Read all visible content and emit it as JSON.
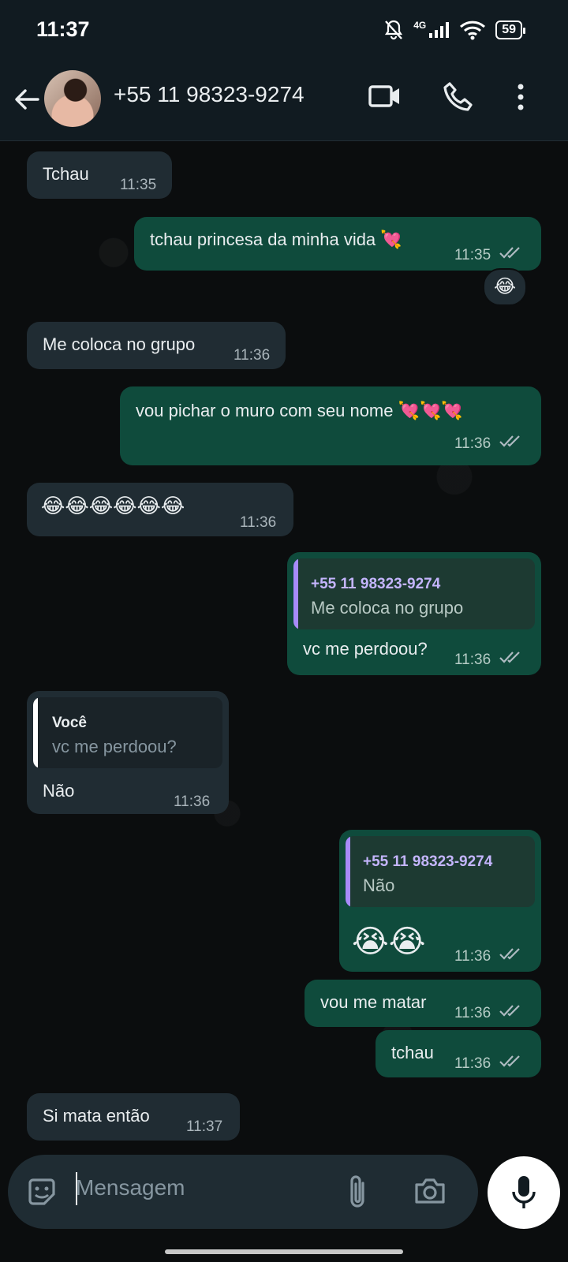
{
  "status": {
    "time": "11:37",
    "network": "4G",
    "battery": "59"
  },
  "header": {
    "contact": "+55 11 98323-9274"
  },
  "messages": [
    {
      "text": "Tchau",
      "time": "11:35"
    },
    {
      "text": "tchau princesa da minha vida 💘",
      "time": "11:35",
      "reaction": "😂"
    },
    {
      "text": "Me coloca no grupo",
      "time": "11:36"
    },
    {
      "text": "vou pichar o muro com seu nome 💘💘💘",
      "time": "11:36"
    },
    {
      "text": "😂😂😂😂😂😂",
      "time": "11:36"
    },
    {
      "quote_name": "+55 11 98323-9274",
      "quote_text": "Me coloca no grupo",
      "text": "vc me perdoou?",
      "time": "11:36"
    },
    {
      "quote_name": "Você",
      "quote_text": "vc me perdoou?",
      "text": "Não",
      "time": "11:36"
    },
    {
      "quote_name": "+55 11 98323-9274",
      "quote_text": "Não",
      "text": "😭😭",
      "time": "11:36"
    },
    {
      "text": "vou me matar",
      "time": "11:36"
    },
    {
      "text": "tchau",
      "time": "11:36"
    },
    {
      "text": "Si mata então",
      "time": "11:37"
    }
  ],
  "composer": {
    "placeholder": "Mensagem"
  },
  "colors": {
    "incoming": "#202c33",
    "outgoing": "#0f4b3c",
    "tick": "#aebac1",
    "quote_purple": "#a78bfa",
    "quote_self": "#ffffff"
  }
}
